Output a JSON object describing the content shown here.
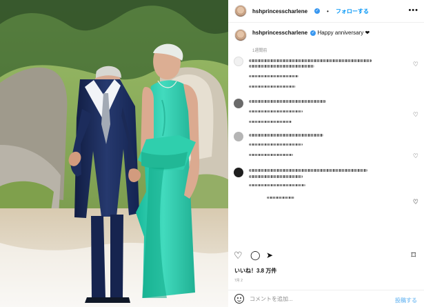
{
  "account": {
    "username": "hshprincesscharlene",
    "verified_mark": "✓",
    "follow_label": "フォローする",
    "menu_label": "•••"
  },
  "caption": {
    "username": "hshprincesscharlene",
    "text": "Happy anniversary ❤",
    "time": "1週間前"
  },
  "comments": [
    {
      "name": "comment-1",
      "heart": "♡"
    },
    {
      "name": "comment-2",
      "heart": "♡"
    },
    {
      "name": "comment-3",
      "heart": "♡"
    },
    {
      "name": "comment-4",
      "heart": "♡"
    },
    {
      "name": "comment-5",
      "heart": "♡"
    }
  ],
  "actions": {
    "like_icon": "heart-icon",
    "comment_icon": "comment-icon",
    "share_icon": "share-icon",
    "save_icon": "bookmark-icon",
    "like_glyph": "♡",
    "comment_glyph": "◯",
    "share_glyph": "➤",
    "save_glyph": "⌑"
  },
  "stats": {
    "likes": "いいね！3.8 万件",
    "date": "7月 2"
  },
  "comment_box": {
    "placeholder": "コメントを追加...",
    "post_label": "投稿する"
  },
  "colors": {
    "accent": "#0095f6",
    "dress": "#3ed6b5",
    "suit": "#1e2f62"
  }
}
